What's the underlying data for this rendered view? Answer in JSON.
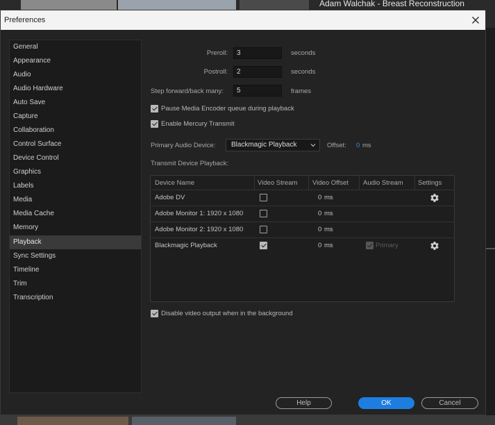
{
  "background": {
    "video_title": "Adam Walchak - Breast Reconstruction"
  },
  "dialog": {
    "title": "Preferences",
    "close_icon": "close-icon"
  },
  "sidebar": {
    "items": [
      {
        "label": "General"
      },
      {
        "label": "Appearance"
      },
      {
        "label": "Audio"
      },
      {
        "label": "Audio Hardware"
      },
      {
        "label": "Auto Save"
      },
      {
        "label": "Capture"
      },
      {
        "label": "Collaboration"
      },
      {
        "label": "Control Surface"
      },
      {
        "label": "Device Control"
      },
      {
        "label": "Graphics"
      },
      {
        "label": "Labels"
      },
      {
        "label": "Media"
      },
      {
        "label": "Media Cache"
      },
      {
        "label": "Memory"
      },
      {
        "label": "Playback",
        "active": true
      },
      {
        "label": "Sync Settings"
      },
      {
        "label": "Timeline"
      },
      {
        "label": "Trim"
      },
      {
        "label": "Transcription"
      }
    ]
  },
  "playback": {
    "preroll_label": "Preroll:",
    "preroll_value": "3",
    "preroll_unit": "seconds",
    "postroll_label": "Postroll:",
    "postroll_value": "2",
    "postroll_unit": "seconds",
    "step_label": "Step forward/back many:",
    "step_value": "5",
    "step_unit": "frames",
    "pause_encoder_label": "Pause Media Encoder queue during playback",
    "pause_encoder_checked": true,
    "mercury_label": "Enable Mercury Transmit",
    "mercury_checked": true,
    "audio_device_label": "Primary Audio Device:",
    "audio_device_value": "Blackmagic Playback",
    "offset_label": "Offset:",
    "offset_value": "0",
    "offset_unit": "ms",
    "transmit_label": "Transmit Device Playback:",
    "disable_output_label": "Disable video output when in the background",
    "disable_output_checked": true
  },
  "device_table": {
    "headers": [
      "Device Name",
      "Video Stream",
      "Video Offset",
      "Audio Stream",
      "Settings"
    ],
    "rows": [
      {
        "name": "Adobe DV",
        "video_stream": false,
        "offset": "0",
        "unit": "ms",
        "audio_stream": "",
        "settings_icon": "gear-icon"
      },
      {
        "name": "Adobe Monitor 1: 1920 x 1080",
        "video_stream": false,
        "offset": "0",
        "unit": "ms",
        "audio_stream": "",
        "settings_icon": ""
      },
      {
        "name": "Adobe Monitor 2: 1920 x 1080",
        "video_stream": false,
        "offset": "0",
        "unit": "ms",
        "audio_stream": "",
        "settings_icon": ""
      },
      {
        "name": "Blackmagic Playback",
        "video_stream": true,
        "offset": "0",
        "unit": "ms",
        "audio_stream": "Primary",
        "settings_icon": "gear-icon"
      }
    ]
  },
  "footer": {
    "help_label": "Help",
    "ok_label": "OK",
    "cancel_label": "Cancel"
  },
  "colors": {
    "accent": "#1e7ee0",
    "value_blue": "#2f8fe8"
  }
}
